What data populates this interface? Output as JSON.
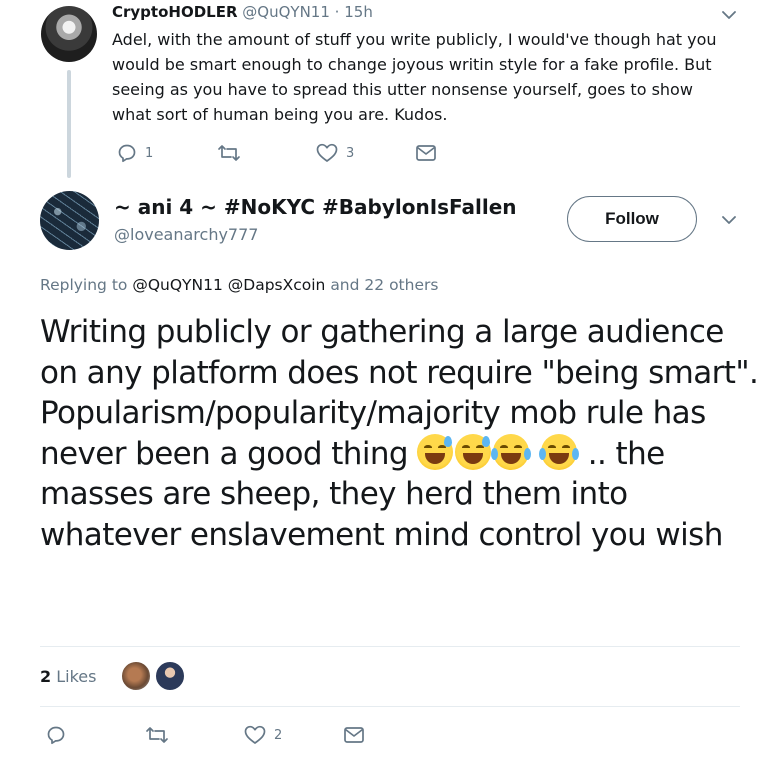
{
  "reply_tweet": {
    "author_name": "CryptoHODLER",
    "author_handle": "@QuQYN11",
    "separator": "·",
    "time": "15h",
    "text": "Adel, with the amount of stuff you write publicly, I would've though hat you would be smart enough to change joyous writin style for a fake profile. But seeing as you have to spread this utter nonsense yourself, goes to show what sort of human being you are. Kudos.",
    "reply_count": "1",
    "retweet_count": "",
    "like_count": "3"
  },
  "main_tweet": {
    "author_name": "~ ani 4 ~ #NoKYC #BabylonIsFallen",
    "author_handle": "@loveanarchy777",
    "follow_label": "Follow",
    "replying_prefix": "Replying to",
    "replying_mentions": "@QuQYN11 @DapsXcoin",
    "replying_and": "and",
    "replying_others": "22 others",
    "text_part1": "Writing publicly or gathering a large audience on any platform does not require \"being smart\". Popularism/popularity/majority mob rule has never been a good thing ",
    "text_part2": " .. the masses are sheep, they herd them into whatever enslavement mind control you wish",
    "emojis": [
      "grinning-sweat-emoji",
      "grinning-sweat-emoji",
      "tears-of-joy-emoji",
      "tears-of-joy-emoji"
    ],
    "likes_count": "2",
    "likes_label": "Likes",
    "reply_count": "",
    "retweet_count": "",
    "like_count": "2"
  },
  "colors": {
    "text": "#14171a",
    "muted": "#657786",
    "divider": "#e6ecf0",
    "thread_line": "#ccd6dd"
  },
  "icons": [
    "reply-icon",
    "retweet-icon",
    "heart-icon",
    "message-icon",
    "chevron-down-icon"
  ]
}
